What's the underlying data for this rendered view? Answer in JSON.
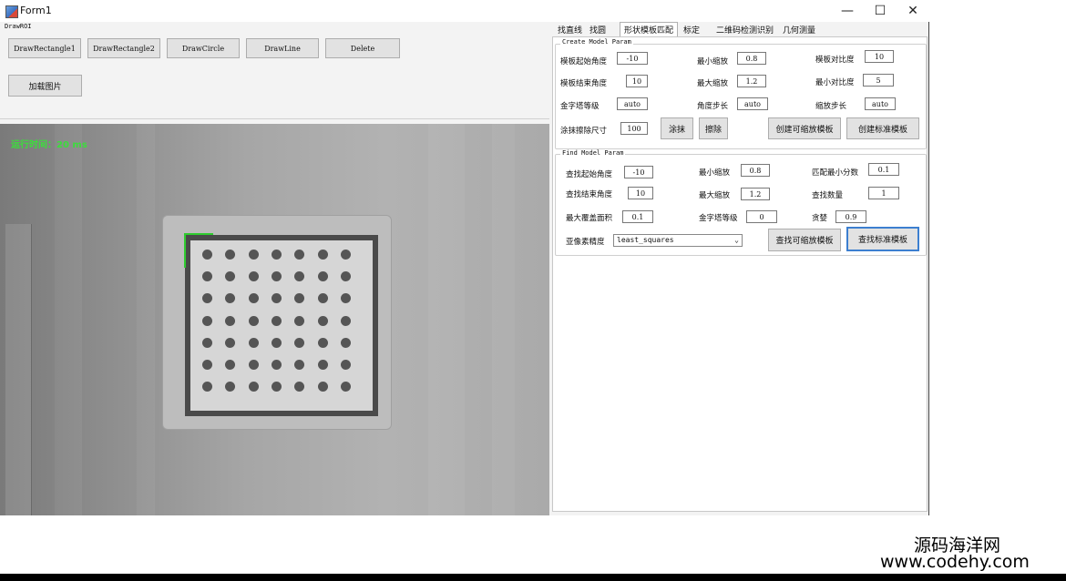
{
  "window": {
    "title": "Form1",
    "minimize": "—",
    "maximize": "☐",
    "close": "✕"
  },
  "left_panel": {
    "group_label": "DrawROI",
    "buttons": [
      "DrawRectangle1",
      "DrawRectangle2",
      "DrawCircle",
      "DrawLine",
      "Delete"
    ],
    "load_image": "加载图片",
    "run_time": "运行时间：20 ms"
  },
  "tabs": [
    "找直线",
    "找圆",
    "形状模板匹配",
    "标定",
    "二维码检测识别",
    "几何测量"
  ],
  "active_tab": "形状模板匹配",
  "create": {
    "group_label": "Create Model Param",
    "rows": [
      [
        {
          "label": "模板起始角度",
          "value": "-10"
        },
        {
          "label": "最小缩放",
          "value": "0.8"
        },
        {
          "label": "模板对比度",
          "value": "10"
        }
      ],
      [
        {
          "label": "模板结束角度",
          "value": "10"
        },
        {
          "label": "最大缩放",
          "value": "1.2"
        },
        {
          "label": "最小对比度",
          "value": "5"
        }
      ],
      [
        {
          "label": "金字塔等级",
          "value": "auto"
        },
        {
          "label": "角度步长",
          "value": "auto"
        },
        {
          "label": "缩放步长",
          "value": "auto"
        }
      ]
    ],
    "erase_size_label": "涂抹擦除尺寸",
    "erase_size_value": "100",
    "smear_button": "涂抹",
    "erase_button": "擦除",
    "create_scaled_button": "创建可缩放模板",
    "create_standard_button": "创建标准模板"
  },
  "find": {
    "group_label": "Find Model Param",
    "rows": [
      [
        {
          "label": "查找起始角度",
          "value": "-10"
        },
        {
          "label": "最小缩放",
          "value": "0.8"
        },
        {
          "label": "匹配最小分数",
          "value": "0.1"
        }
      ],
      [
        {
          "label": "查找结束角度",
          "value": "10"
        },
        {
          "label": "最大缩放",
          "value": "1.2"
        },
        {
          "label": "查找数量",
          "value": "1"
        }
      ],
      [
        {
          "label": "最大覆盖面积",
          "value": "0.1"
        },
        {
          "label": "金字塔等级",
          "value": "0"
        },
        {
          "label": "贪婪",
          "value": "0.9"
        }
      ]
    ],
    "subpixel_label": "亚像素精度",
    "subpixel_value": "least_squares",
    "find_scaled_button": "查找可缩放模板",
    "find_standard_button": "查找标准模板"
  },
  "watermark": {
    "line1": "源码海洋网",
    "line2": "www.codehy.com"
  }
}
